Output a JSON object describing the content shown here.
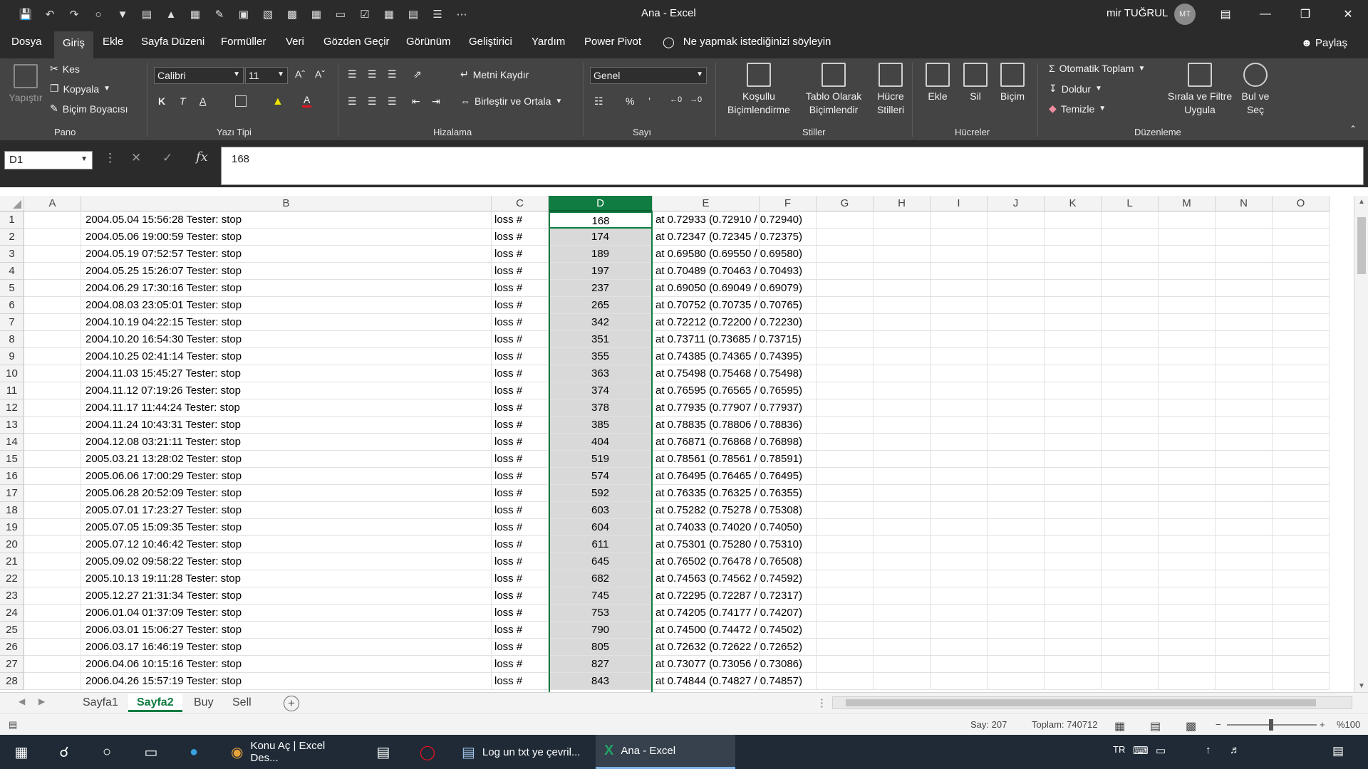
{
  "window": {
    "title": "Ana  -  Excel",
    "user_name": "mir TUĞRUL",
    "user_initials": "MT"
  },
  "ribbon_tabs": [
    "Dosya",
    "Giriş",
    "Ekle",
    "Sayfa Düzeni",
    "Formüller",
    "Veri",
    "Gözden Geçir",
    "Görünüm",
    "Geliştirici",
    "Yardım",
    "Power Pivot"
  ],
  "tell_me": "Ne yapmak istediğinizi söyleyin",
  "share": "Paylaş",
  "ribbon": {
    "clipboard": {
      "paste": "Yapıştır",
      "cut": "Kes",
      "copy": "Kopyala",
      "format_painter": "Biçim Boyacısı",
      "group": "Pano"
    },
    "font": {
      "name": "Calibri",
      "size": "11",
      "bold": "K",
      "italic": "T",
      "underline": "A",
      "group": "Yazı Tipi"
    },
    "alignment": {
      "wrap": "Metni Kaydır",
      "merge": "Birleştir ve Ortala",
      "group": "Hizalama"
    },
    "number": {
      "format": "Genel",
      "percent": "%",
      "comma": "’",
      "group": "Sayı"
    },
    "styles": {
      "conditional": [
        "Koşullu",
        "Biçimlendirme"
      ],
      "table": [
        "Tablo Olarak",
        "Biçimlendir"
      ],
      "cell": [
        "Hücre",
        "Stilleri"
      ],
      "group": "Stiller"
    },
    "cells": {
      "insert": "Ekle",
      "delete": "Sil",
      "format": "Biçim",
      "group": "Hücreler"
    },
    "editing": {
      "autosum": "Otomatik Toplam",
      "fill": "Doldur",
      "clear": "Temizle",
      "sort": [
        "Sırala ve Filtre",
        "Uygula"
      ],
      "find": [
        "Bul ve",
        "Seç"
      ],
      "group": "Düzenleme"
    }
  },
  "formula_bar": {
    "name_box": "D1",
    "formula": "168"
  },
  "columns": [
    "A",
    "B",
    "C",
    "D",
    "E",
    "F",
    "G",
    "H",
    "I",
    "J",
    "K",
    "L",
    "M",
    "N",
    "O"
  ],
  "rows": [
    {
      "b": "2004.05.04 15:56:28  Tester: stop",
      "c": "loss #",
      "d": "168",
      "e": "at 0.72933 (0.72910 / 0.72940)"
    },
    {
      "b": "2004.05.06 19:00:59  Tester: stop",
      "c": "loss #",
      "d": "174",
      "e": "at 0.72347 (0.72345 / 0.72375)"
    },
    {
      "b": "2004.05.19 07:52:57  Tester: stop",
      "c": "loss #",
      "d": "189",
      "e": "at 0.69580 (0.69550 / 0.69580)"
    },
    {
      "b": "2004.05.25 15:26:07  Tester: stop",
      "c": "loss #",
      "d": "197",
      "e": "at 0.70489 (0.70463 / 0.70493)"
    },
    {
      "b": "2004.06.29 17:30:16  Tester: stop",
      "c": "loss #",
      "d": "237",
      "e": "at 0.69050 (0.69049 / 0.69079)"
    },
    {
      "b": "2004.08.03 23:05:01  Tester: stop",
      "c": "loss #",
      "d": "265",
      "e": "at 0.70752 (0.70735 / 0.70765)"
    },
    {
      "b": "2004.10.19 04:22:15  Tester: stop",
      "c": "loss #",
      "d": "342",
      "e": "at 0.72212 (0.72200 / 0.72230)"
    },
    {
      "b": "2004.10.20 16:54:30  Tester: stop",
      "c": "loss #",
      "d": "351",
      "e": "at 0.73711 (0.73685 / 0.73715)"
    },
    {
      "b": "2004.10.25 02:41:14  Tester: stop",
      "c": "loss #",
      "d": "355",
      "e": "at 0.74385 (0.74365 / 0.74395)"
    },
    {
      "b": "2004.11.03 15:45:27  Tester: stop",
      "c": "loss #",
      "d": "363",
      "e": "at 0.75498 (0.75468 / 0.75498)"
    },
    {
      "b": "2004.11.12 07:19:26  Tester: stop",
      "c": "loss #",
      "d": "374",
      "e": "at 0.76595 (0.76565 / 0.76595)"
    },
    {
      "b": "2004.11.17 11:44:24  Tester: stop",
      "c": "loss #",
      "d": "378",
      "e": "at 0.77935 (0.77907 / 0.77937)"
    },
    {
      "b": "2004.11.24 10:43:31  Tester: stop",
      "c": "loss #",
      "d": "385",
      "e": "at 0.78835 (0.78806 / 0.78836)"
    },
    {
      "b": "2004.12.08 03:21:11  Tester: stop",
      "c": "loss #",
      "d": "404",
      "e": "at 0.76871 (0.76868 / 0.76898)"
    },
    {
      "b": "2005.03.21 13:28:02  Tester: stop",
      "c": "loss #",
      "d": "519",
      "e": "at 0.78561 (0.78561 / 0.78591)"
    },
    {
      "b": "2005.06.06 17:00:29  Tester: stop",
      "c": "loss #",
      "d": "574",
      "e": "at 0.76495 (0.76465 / 0.76495)"
    },
    {
      "b": "2005.06.28 20:52:09  Tester: stop",
      "c": "loss #",
      "d": "592",
      "e": "at 0.76335 (0.76325 / 0.76355)"
    },
    {
      "b": "2005.07.01 17:23:27  Tester: stop",
      "c": "loss #",
      "d": "603",
      "e": "at 0.75282 (0.75278 / 0.75308)"
    },
    {
      "b": "2005.07.05 15:09:35  Tester: stop",
      "c": "loss #",
      "d": "604",
      "e": "at 0.74033 (0.74020 / 0.74050)"
    },
    {
      "b": "2005.07.12 10:46:42  Tester: stop",
      "c": "loss #",
      "d": "611",
      "e": "at 0.75301 (0.75280 / 0.75310)"
    },
    {
      "b": "2005.09.02 09:58:22  Tester: stop",
      "c": "loss #",
      "d": "645",
      "e": "at 0.76502 (0.76478 / 0.76508)"
    },
    {
      "b": "2005.10.13 19:11:28  Tester: stop",
      "c": "loss #",
      "d": "682",
      "e": "at 0.74563 (0.74562 / 0.74592)"
    },
    {
      "b": "2005.12.27 21:31:34  Tester: stop",
      "c": "loss #",
      "d": "745",
      "e": "at 0.72295 (0.72287 / 0.72317)"
    },
    {
      "b": "2006.01.04 01:37:09  Tester: stop",
      "c": "loss #",
      "d": "753",
      "e": "at 0.74205 (0.74177 / 0.74207)"
    },
    {
      "b": "2006.03.01 15:06:27  Tester: stop",
      "c": "loss #",
      "d": "790",
      "e": "at 0.74500 (0.74472 / 0.74502)"
    },
    {
      "b": "2006.03.17 16:46:19  Tester: stop",
      "c": "loss #",
      "d": "805",
      "e": "at 0.72632 (0.72622 / 0.72652)"
    },
    {
      "b": "2006.04.06 10:15:16  Tester: stop",
      "c": "loss #",
      "d": "827",
      "e": "at 0.73077 (0.73056 / 0.73086)"
    },
    {
      "b": "2006.04.26 15:57:19  Tester: stop",
      "c": "loss #",
      "d": "843",
      "e": "at 0.74844 (0.74827 / 0.74857)"
    }
  ],
  "sheets": [
    "Sayfa1",
    "Sayfa2",
    "Buy",
    "Sell"
  ],
  "active_sheet": "Sayfa2",
  "status": {
    "count": "Say: 207",
    "sum": "Toplam: 740712",
    "zoom": "%100"
  },
  "taskbar": {
    "apps": [
      "Konu Aç | Excel Des...",
      "Log un txt ye çevril...",
      "Ana - Excel"
    ],
    "lang": "TR"
  },
  "colors": {
    "excel_green": "#107c41",
    "ribbon_dark": "#444444",
    "title_dark": "#2b2b2b"
  }
}
